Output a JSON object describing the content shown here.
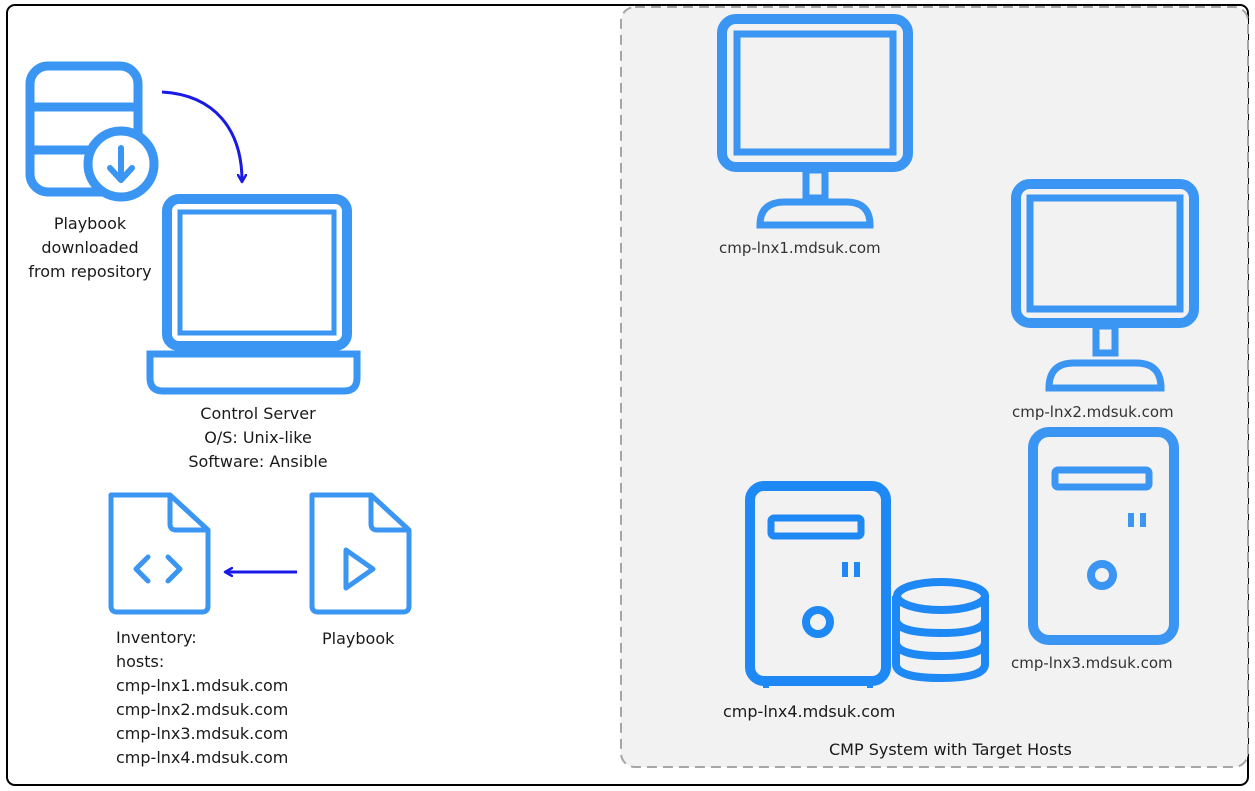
{
  "colors": {
    "icon_blue": "#3a95f3",
    "arrow_blue": "#1a1ae6",
    "panel_fill": "#f2f2f2",
    "panel_border": "#a6a6a6",
    "frame_border": "#000000"
  },
  "repository": {
    "icon": "database-download-icon",
    "caption": [
      "Playbook",
      "downloaded",
      "from repository"
    ]
  },
  "control_server": {
    "icon": "laptop-icon",
    "caption": [
      "Control Server",
      "O/S: Unix-like",
      "Software: Ansible"
    ]
  },
  "inventory": {
    "icon": "code-file-icon",
    "caption": [
      "Inventory:",
      "hosts:",
      "cmp-lnx1.mdsuk.com",
      "cmp-lnx2.mdsuk.com",
      "cmp-lnx3.mdsuk.com",
      "cmp-lnx4.mdsuk.com"
    ]
  },
  "playbook": {
    "icon": "play-file-icon",
    "caption": "Playbook"
  },
  "cmp_system": {
    "title": "CMP System with Target Hosts",
    "hosts": [
      {
        "icon": "monitor-icon",
        "label": "cmp-lnx1.mdsuk.com"
      },
      {
        "icon": "monitor-icon",
        "label": "cmp-lnx2.mdsuk.com"
      },
      {
        "icon": "tower-server-icon",
        "label": "cmp-lnx3.mdsuk.com"
      },
      {
        "icon": "tower-server-with-database-icon",
        "label": "cmp-lnx4.mdsuk.com"
      }
    ]
  }
}
